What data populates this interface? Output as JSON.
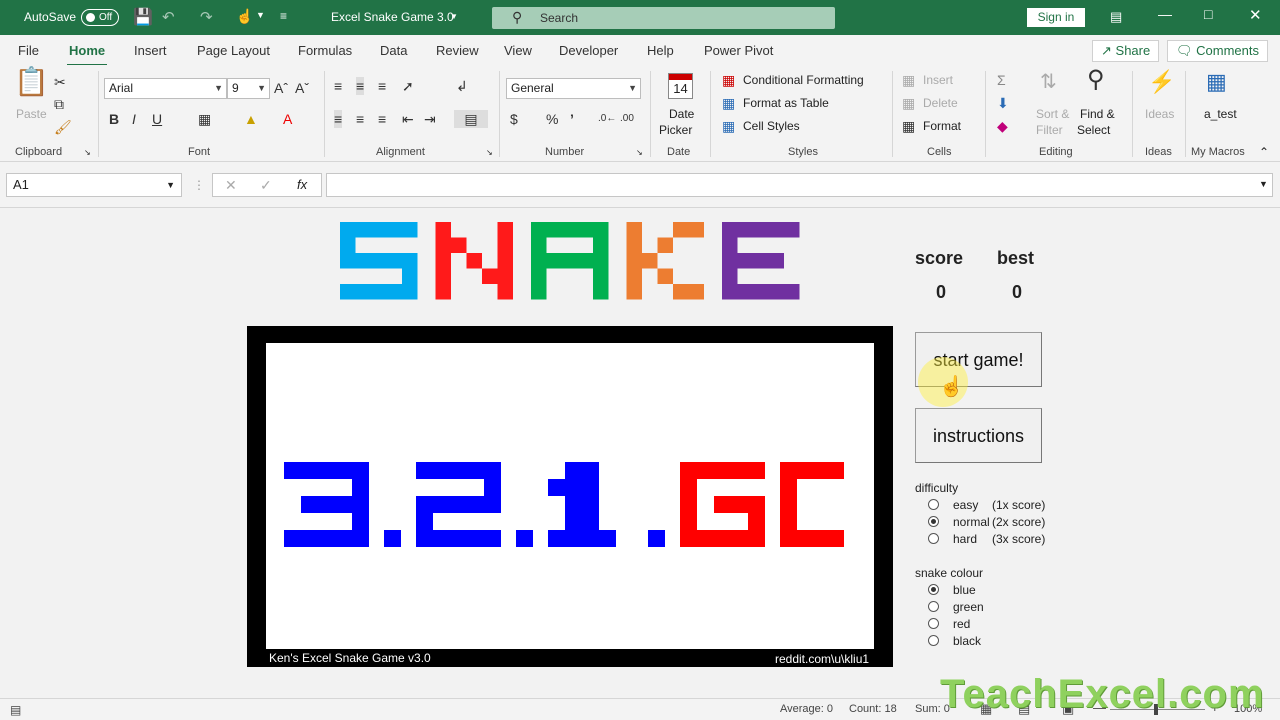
{
  "titlebar": {
    "autosave_label": "AutoSave",
    "autosave_state": "Off",
    "doc_title": "Excel Snake Game 3.0",
    "search_placeholder": "Search",
    "signin_label": "Sign in"
  },
  "tabs": [
    "File",
    "Home",
    "Insert",
    "Page Layout",
    "Formulas",
    "Data",
    "Review",
    "View",
    "Developer",
    "Help",
    "Power Pivot"
  ],
  "tabs_active": "Home",
  "share_label": "Share",
  "comments_label": "Comments",
  "ribbon": {
    "clipboard": {
      "label": "Clipboard",
      "paste": "Paste"
    },
    "font": {
      "label": "Font",
      "name": "Arial",
      "size": "9"
    },
    "alignment": {
      "label": "Alignment"
    },
    "number": {
      "label": "Number",
      "format": "General"
    },
    "date": {
      "label": "Date",
      "day": "14",
      "btn": "Date",
      "btn2": "Picker"
    },
    "styles": {
      "label": "Styles",
      "cond": "Conditional Formatting",
      "table": "Format as Table",
      "cell": "Cell Styles"
    },
    "cells": {
      "label": "Cells",
      "insert": "Insert",
      "delete": "Delete",
      "format": "Format"
    },
    "editing": {
      "label": "Editing",
      "sort": "Sort &",
      "sort2": "Filter",
      "find": "Find &",
      "find2": "Select"
    },
    "ideas": {
      "label": "Ideas",
      "btn": "Ideas"
    },
    "macros": {
      "label": "My Macros",
      "btn": "a_test"
    }
  },
  "formula_bar": {
    "name_box": "A1",
    "value": ""
  },
  "game": {
    "logo": "SNAKE",
    "logo_colors": [
      "#00aaee",
      "#ff1a1a",
      "#00b050",
      "#ed7d31",
      "#7030a0"
    ],
    "countdown": "3.2.1.",
    "go": "GO!",
    "countdown_color": "#0000ff",
    "go_color": "#ff0000",
    "footer_left": "Ken's Excel Snake Game v3.0",
    "footer_right": "reddit.com\\u\\kliu1",
    "score_label": "score",
    "best_label": "best",
    "score": "0",
    "best": "0",
    "start_btn": "start game!",
    "instructions_btn": "instructions",
    "difficulty_label": "difficulty",
    "difficulty": [
      {
        "name": "easy",
        "mult": "(1x score)",
        "selected": false
      },
      {
        "name": "normal",
        "mult": "(2x score)",
        "selected": true
      },
      {
        "name": "hard",
        "mult": "(3x score)",
        "selected": false
      }
    ],
    "colour_label": "snake colour",
    "colours": [
      {
        "name": "blue",
        "selected": true
      },
      {
        "name": "green",
        "selected": false
      },
      {
        "name": "red",
        "selected": false
      },
      {
        "name": "black",
        "selected": false
      }
    ]
  },
  "status": {
    "average": "Average: 0",
    "count": "Count: 18",
    "sum": "Sum: 0",
    "zoom": "100%"
  },
  "watermark": "TeachExcel.com"
}
